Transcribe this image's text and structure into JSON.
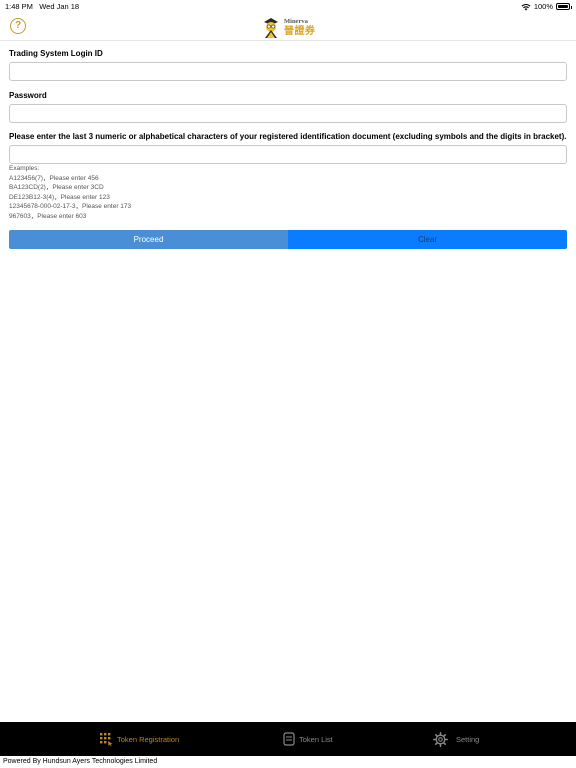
{
  "status_bar": {
    "time": "1:48 PM",
    "date": "Wed Jan 18",
    "battery": "100%"
  },
  "header": {
    "logo_en": "Minerva",
    "logo_cn": "晉證券"
  },
  "form": {
    "login_label": "Trading System Login ID",
    "login_value": "",
    "password_label": "Password",
    "password_value": "",
    "id_label": "Please enter the last 3 numeric or alphabetical characters of your registered identification document (excluding symbols and the digits in bracket).",
    "id_value": "",
    "examples_title": "Examples:",
    "examples": [
      "A123456(7)，Please enter 456",
      "BA123CD(2)，Please enter 3CD",
      "DE123B12-3(4)，Please enter 123",
      "12345678-000-02-17-3，Please enter 173",
      "967603，Please enter 603"
    ]
  },
  "buttons": {
    "proceed": "Proceed",
    "clear": "Clear"
  },
  "tabs": [
    {
      "label": "Token Registration",
      "icon": "keypad-icon",
      "active": true
    },
    {
      "label": "Token List",
      "icon": "token-icon",
      "active": false
    },
    {
      "label": "Setting",
      "icon": "gear-icon",
      "active": false
    }
  ],
  "footer": "Powered By Hundsun Ayers Technologies Limited",
  "colors": {
    "accent": "#c08622",
    "primary_button": "#4a8fd5",
    "secondary_button": "#0a7cff",
    "tab_bar": "#000000"
  }
}
